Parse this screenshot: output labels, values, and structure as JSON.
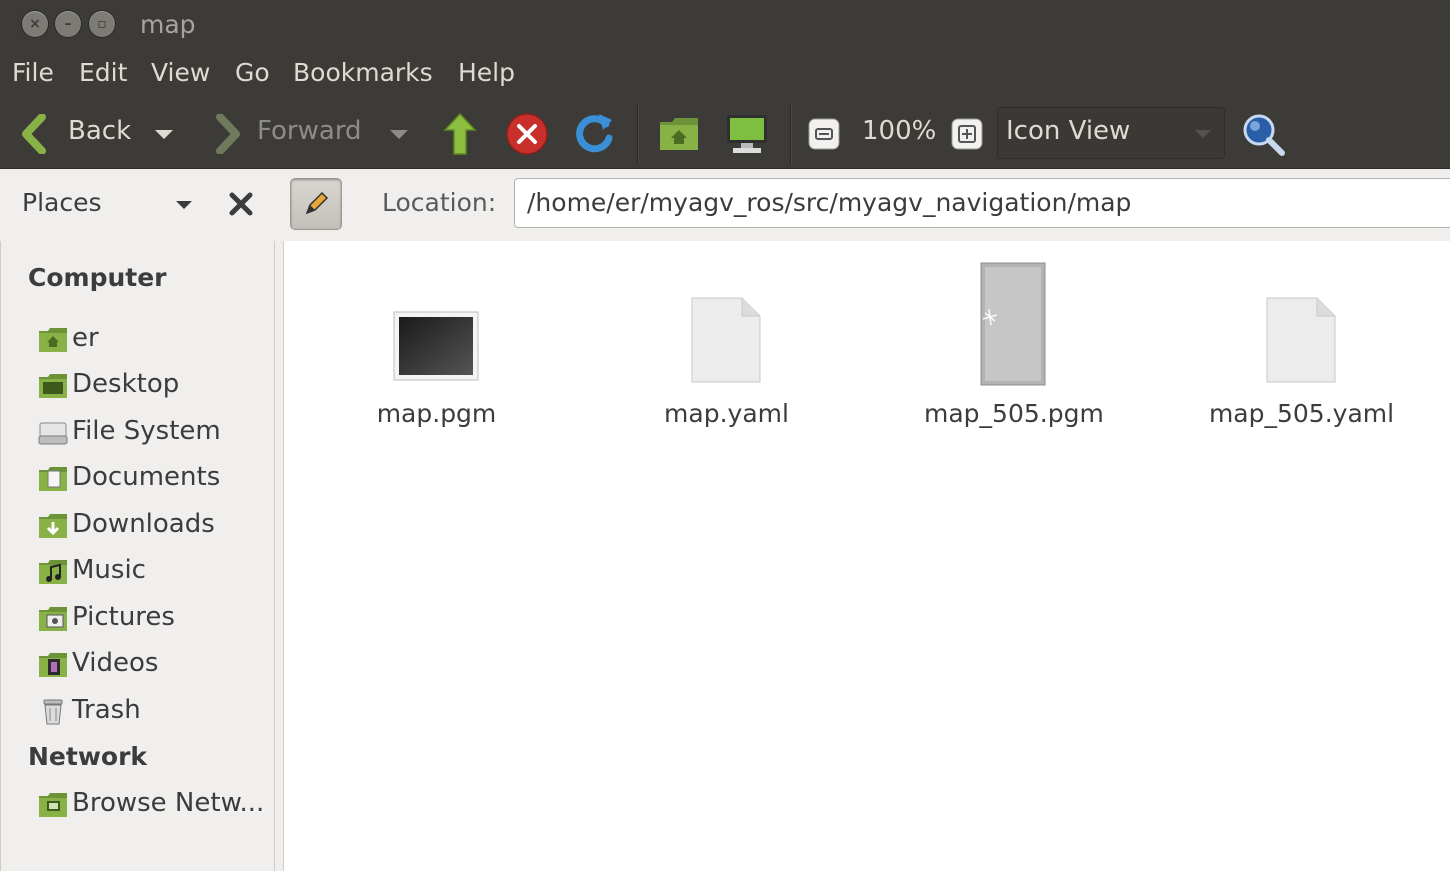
{
  "window": {
    "title": "map"
  },
  "menu": [
    "File",
    "Edit",
    "View",
    "Go",
    "Bookmarks",
    "Help"
  ],
  "toolbar": {
    "back_label": "Back",
    "forward_label": "Forward",
    "zoom_level": "100%",
    "view_mode": "Icon View"
  },
  "locationbar": {
    "pane_selector": "Places",
    "location_label": "Location:",
    "path": "/home/er/myagv_ros/src/myagv_navigation/map"
  },
  "sidebar": {
    "sections": [
      {
        "title": "Computer",
        "items": [
          {
            "label": "er",
            "icon": "home-folder-icon"
          },
          {
            "label": "Desktop",
            "icon": "desktop-folder-icon"
          },
          {
            "label": "File System",
            "icon": "drive-icon"
          },
          {
            "label": "Documents",
            "icon": "documents-folder-icon"
          },
          {
            "label": "Downloads",
            "icon": "downloads-folder-icon"
          },
          {
            "label": "Music",
            "icon": "music-folder-icon"
          },
          {
            "label": "Pictures",
            "icon": "pictures-folder-icon"
          },
          {
            "label": "Videos",
            "icon": "videos-folder-icon"
          },
          {
            "label": "Trash",
            "icon": "trash-icon"
          }
        ]
      },
      {
        "title": "Network",
        "items": [
          {
            "label": "Browse Netw...",
            "icon": "network-folder-icon"
          }
        ]
      }
    ]
  },
  "files": [
    {
      "name": "map.pgm",
      "icon": "image-thumbnail-dark"
    },
    {
      "name": "map.yaml",
      "icon": "text-document-icon"
    },
    {
      "name": "map_505.pgm",
      "icon": "image-thumbnail-gray"
    },
    {
      "name": "map_505.yaml",
      "icon": "text-document-icon"
    }
  ],
  "colors": {
    "chrome": "#3c3b37",
    "chrome_text": "#dfdbd2",
    "folder_green": "#87a556"
  }
}
